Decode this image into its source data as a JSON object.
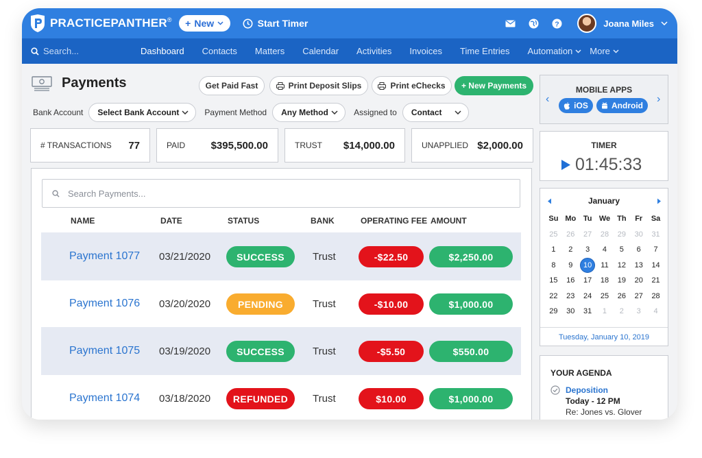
{
  "app": {
    "logo_text": "PRACTICEPANTHER",
    "logo_tm": "®",
    "new_label": "New",
    "start_timer_label": "Start Timer",
    "user_name": "Joana Miles"
  },
  "nav": {
    "search_placeholder": "Search...",
    "items": [
      "Dashboard",
      "Contacts",
      "Matters",
      "Calendar",
      "Activities",
      "Invoices",
      "Time Entries",
      "Automation",
      "More"
    ]
  },
  "page": {
    "title": "Payments",
    "buttons": {
      "get_paid_fast": "Get Paid Fast",
      "print_deposit_slips": "Print Deposit Slips",
      "print_echecks": "Print eChecks",
      "new_payments": "+ New Payments"
    },
    "filters": {
      "bank_account_label": "Bank Account",
      "bank_account_value": "Select Bank Account",
      "payment_method_label": "Payment Method",
      "payment_method_value": "Any Method",
      "assigned_to_label": "Assigned to",
      "assigned_to_value": "Contact"
    },
    "stats": {
      "transactions_label": "# TRANSACTIONS",
      "transactions_value": "77",
      "paid_label": "PAID",
      "paid_value": "$395,500.00",
      "trust_label": "TRUST",
      "trust_value": "$14,000.00",
      "unapplied_label": "UNAPPLIED",
      "unapplied_value": "$2,000.00"
    }
  },
  "table": {
    "search_placeholder": "Search Payments...",
    "headers": {
      "name": "NAME",
      "date": "DATE",
      "status": "STATUS",
      "bank": "BANK",
      "fee": "OPERATING FEE",
      "amount": "AMOUNT"
    },
    "rows": [
      {
        "name": "Payment 1077",
        "date": "03/21/2020",
        "status": "SUCCESS",
        "bank": "Trust",
        "fee": "-$22.50",
        "amount": "$2,250.00"
      },
      {
        "name": "Payment 1076",
        "date": "03/20/2020",
        "status": "PENDING",
        "bank": "Trust",
        "fee": "-$10.00",
        "amount": "$1,000.00"
      },
      {
        "name": "Payment 1075",
        "date": "03/19/2020",
        "status": "SUCCESS",
        "bank": "Trust",
        "fee": "-$5.50",
        "amount": "$550.00"
      },
      {
        "name": "Payment 1074",
        "date": "03/18/2020",
        "status": "REFUNDED",
        "bank": "Trust",
        "fee": "$10.00",
        "amount": "$1,000.00"
      }
    ]
  },
  "sidebar": {
    "mobile_apps_title": "MOBILE APPS",
    "ios_label": "iOS",
    "android_label": "Android",
    "timer_title": "TIMER",
    "timer_value": "01:45:33",
    "calendar": {
      "month": "January",
      "days_of_week": [
        "Su",
        "Mo",
        "Tu",
        "We",
        "Th",
        "Fr",
        "Sa"
      ],
      "rows": [
        [
          "25",
          "26",
          "27",
          "28",
          "29",
          "30",
          "31"
        ],
        [
          "1",
          "2",
          "3",
          "4",
          "5",
          "6",
          "7"
        ],
        [
          "8",
          "9",
          "10",
          "11",
          "12",
          "13",
          "14"
        ],
        [
          "15",
          "16",
          "17",
          "18",
          "19",
          "20",
          "21"
        ],
        [
          "22",
          "23",
          "24",
          "25",
          "26",
          "27",
          "28"
        ],
        [
          "29",
          "30",
          "31",
          "1",
          "2",
          "3",
          "4"
        ]
      ],
      "selected_date_text": "Tuesday, January 10, 2019"
    },
    "agenda": {
      "title": "YOUR AGENDA",
      "item_title": "Deposition",
      "item_time": "Today - 12 PM",
      "item_detail": "Re: Jones vs. Glover"
    }
  },
  "colors": {
    "topbar": "#2f7fe0",
    "navbar": "#1b64c4",
    "success": "#2db36f",
    "pending": "#f9ac2f",
    "refunded": "#e3131b",
    "link": "#2a74cf"
  }
}
